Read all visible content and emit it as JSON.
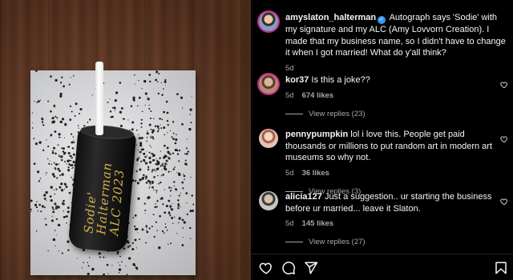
{
  "post": {
    "author": "amyslaton_halterman",
    "caption": "Autograph says 'Sodie' with my signature and my ALC (Amy Lovvorn Creation). I made that my business name, so I didn't have to change it when I got married! What do y'all think?",
    "time": "5d",
    "can_text": "Sodie' Halterman ALC 2023"
  },
  "comments": [
    {
      "user": "kor37",
      "text": "Is this a joke??",
      "time": "5d",
      "likes": "674 likes",
      "replies": "View replies (23)"
    },
    {
      "user": "pennypumpkin",
      "text": "lol i love this. People get paid thousands or millions to put random art in modern art museums so why not.",
      "time": "5d",
      "likes": "36 likes",
      "replies": "View replies (3)"
    },
    {
      "user": "alicia127",
      "text": "Just a suggestion.. ur starting the business before ur married... leave it Slaton.",
      "time": "5d",
      "likes": "145 likes",
      "replies": "View replies (27)"
    }
  ],
  "icons": {
    "verified": "verified-badge-icon",
    "like": "heart-icon",
    "comment": "comment-icon",
    "share": "send-icon",
    "save": "bookmark-icon"
  },
  "colors": {
    "background": "#000000",
    "verified": "#3897f0",
    "muted": "#a8a8a8"
  }
}
